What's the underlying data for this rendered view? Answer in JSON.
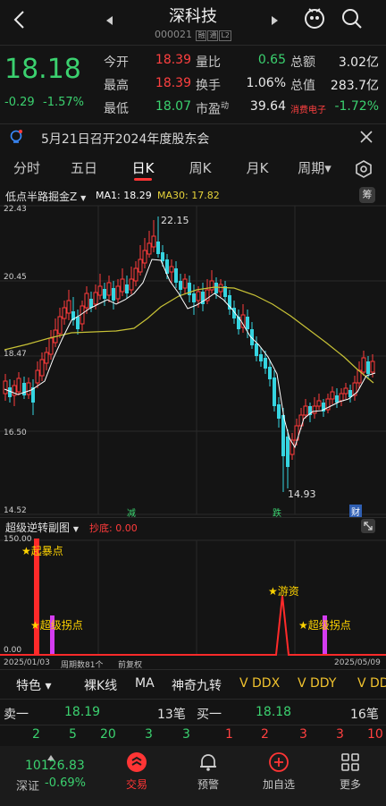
{
  "header": {
    "title": "深科技",
    "code": "000021",
    "tags": [
      "融",
      "通",
      "L2"
    ]
  },
  "quote": {
    "price": "18.18",
    "change": "-0.29",
    "change_pct": "-1.57%",
    "rows": [
      {
        "l1": "今开",
        "v1": "18.39",
        "l2": "量比",
        "v2": "0.65",
        "l3": "总额",
        "v3": "3.02亿"
      },
      {
        "l1": "最高",
        "v1": "18.39",
        "l2": "换手",
        "v2": "1.06%",
        "l3": "总值",
        "v3": "283.7亿"
      },
      {
        "l1": "最低",
        "v1": "18.07",
        "l2": "市盈",
        "l2sup": "动",
        "v2": "39.64",
        "l3": "消费电子",
        "v3": "-1.72%"
      }
    ],
    "colors": {
      "up": "#ff4040",
      "down": "#3bd16f"
    }
  },
  "notice": {
    "text": "5月21日召开2024年度股东会"
  },
  "tabs": [
    "分时",
    "五日",
    "日K",
    "周K",
    "月K",
    "周期▾"
  ],
  "active_tab": "日K",
  "indicator_bar": {
    "name": "低点半路掘金Z",
    "ma1": "MA1: 18.29",
    "ma30": "MA30: 17.82",
    "badge": "筹"
  },
  "price_axis": {
    "labels": [
      "22.43",
      "20.45",
      "18.47",
      "16.50",
      "14.52"
    ],
    "high_label": "22.15",
    "low_label": "14.93"
  },
  "markers": {
    "jian": "减",
    "die": "跌",
    "cai": "财"
  },
  "sub_panel": {
    "name": "超级逆转副图",
    "value_label": "抄底: 0.00",
    "y_labels": [
      "150.00",
      "0.00"
    ],
    "annotations": {
      "baodian": "★起暴点",
      "guaidian1": "★超级拐点",
      "youzi": "★游资",
      "guaidian2": "★超级拐点"
    }
  },
  "footer_axis": {
    "start": "2025/01/03",
    "period_count": "周期数81个",
    "adj": "前复权",
    "end": "2025/05/09"
  },
  "buttons": [
    "特色 ▾",
    "裸K线",
    "MA",
    "神奇九转",
    "V DDX",
    "V DDY",
    "V DD"
  ],
  "order_book": {
    "sell_label": "卖一",
    "sell_price": "18.19",
    "sell_vol": "13笔",
    "buy_label": "买一",
    "buy_price": "18.18",
    "buy_vol": "16笔",
    "sell_queue": [
      "2",
      "5",
      "20",
      "3",
      "3"
    ],
    "buy_queue": [
      "1",
      "2",
      "3",
      "3",
      "10"
    ]
  },
  "bottom_nav": {
    "index_value": "10126.83",
    "index_name": "深证",
    "index_change": "-0.69%",
    "items": [
      "交易",
      "预警",
      "加自选",
      "更多"
    ]
  }
}
